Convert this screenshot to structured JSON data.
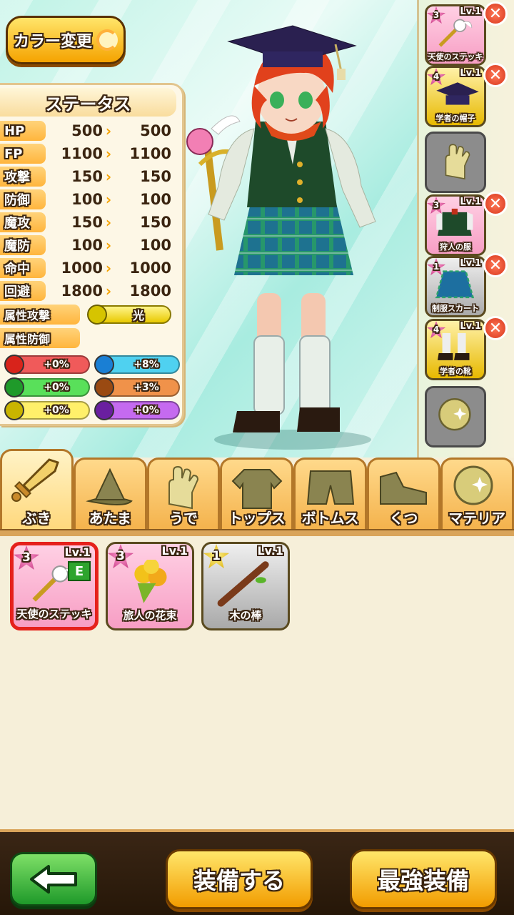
{
  "header": {
    "color_change_label": "カラー変更"
  },
  "status": {
    "title": "ステータス",
    "stats": [
      {
        "label": "HP",
        "current": "500",
        "new": "500"
      },
      {
        "label": "FP",
        "current": "1100",
        "new": "1100"
      },
      {
        "label": "攻撃",
        "current": "150",
        "new": "150"
      },
      {
        "label": "防御",
        "current": "100",
        "new": "100"
      },
      {
        "label": "魔攻",
        "current": "150",
        "new": "150"
      },
      {
        "label": "魔防",
        "current": "100",
        "new": "100"
      },
      {
        "label": "命中",
        "current": "1000",
        "new": "1000"
      },
      {
        "label": "回避",
        "current": "1800",
        "new": "1800"
      }
    ],
    "attr_attack_label": "属性攻撃",
    "attr_attack_value": "光",
    "attr_defense_label": "属性防御",
    "resistances": [
      {
        "element": "fire",
        "value": "+0%",
        "color": "#f05a5a",
        "gem": "#d8231b"
      },
      {
        "element": "water",
        "value": "+8%",
        "color": "#4fd1f0",
        "gem": "#1a7fd4"
      },
      {
        "element": "wind",
        "value": "+0%",
        "color": "#59e05a",
        "gem": "#1f9a2a"
      },
      {
        "element": "earth",
        "value": "+3%",
        "color": "#f0924a",
        "gem": "#9a4a12"
      },
      {
        "element": "light",
        "value": "+0%",
        "color": "#fff06a",
        "gem": "#c9b400"
      },
      {
        "element": "dark",
        "value": "+0%",
        "color": "#c56af0",
        "gem": "#6a1fa0"
      }
    ]
  },
  "equipped": [
    {
      "rarity": "3",
      "level": "Lv.1",
      "name": "天使のステッキ",
      "removable": true,
      "icon": "angel-staff-icon"
    },
    {
      "rarity": "4",
      "level": "Lv.1",
      "name": "学者の帽子",
      "removable": true,
      "icon": "scholar-hat-icon"
    },
    {
      "rarity": "",
      "level": "",
      "name": "",
      "removable": false,
      "icon": "glove-icon"
    },
    {
      "rarity": "3",
      "level": "Lv.1",
      "name": "狩人の服",
      "removable": true,
      "icon": "hunter-clothes-icon"
    },
    {
      "rarity": "1",
      "level": "Lv.1",
      "name": "制服スカート",
      "removable": true,
      "icon": "uniform-skirt-icon"
    },
    {
      "rarity": "4",
      "level": "Lv.1",
      "name": "学者の靴",
      "removable": true,
      "icon": "scholar-shoes-icon"
    },
    {
      "rarity": "",
      "level": "",
      "name": "",
      "removable": false,
      "icon": "materia-orb-icon"
    }
  ],
  "tabs": [
    {
      "label": "ぶき",
      "icon": "sword-icon",
      "active": true
    },
    {
      "label": "あたま",
      "icon": "hat-icon",
      "active": false
    },
    {
      "label": "うで",
      "icon": "glove-icon",
      "active": false
    },
    {
      "label": "トップス",
      "icon": "shirt-icon",
      "active": false
    },
    {
      "label": "ボトムス",
      "icon": "shorts-icon",
      "active": false
    },
    {
      "label": "くつ",
      "icon": "shoe-icon",
      "active": false
    },
    {
      "label": "マテリア",
      "icon": "materia-orb-icon",
      "active": false
    }
  ],
  "inventory": [
    {
      "rarity": "3",
      "level": "Lv.1",
      "name": "天使のステッキ",
      "equipped_mark": "E",
      "selected": true,
      "icon": "angel-staff-icon"
    },
    {
      "rarity": "3",
      "level": "Lv.1",
      "name": "旅人の花束",
      "equipped_mark": "",
      "selected": false,
      "icon": "bouquet-icon"
    },
    {
      "rarity": "1",
      "level": "Lv.1",
      "name": "木の棒",
      "equipped_mark": "",
      "selected": false,
      "icon": "wooden-stick-icon"
    }
  ],
  "footer": {
    "equip_label": "装備する",
    "strongest_label": "最強装備"
  }
}
